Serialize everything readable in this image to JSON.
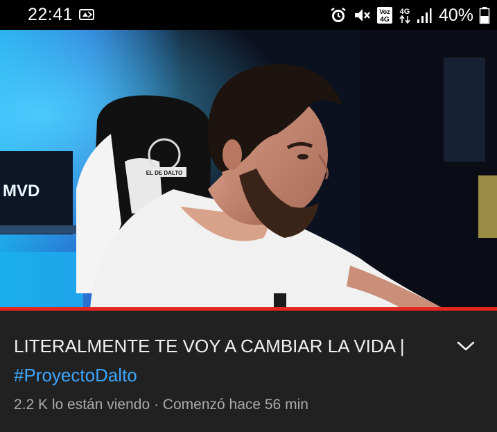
{
  "status_bar": {
    "time": "22:41",
    "battery_percent": "40%",
    "network_label": "4G",
    "volte_label_top": "Voz",
    "volte_label_bottom": "4G",
    "icons": [
      "alarm-icon",
      "mute-icon",
      "volte-icon",
      "network-4g-icon",
      "signal-icon",
      "battery-icon",
      "cast-notification-icon"
    ]
  },
  "video": {
    "watermark_chair": "EL DE DALTO",
    "monitor_brand": "MVD",
    "progress": 1.0,
    "progress_color": "#e52620"
  },
  "info": {
    "title_text": "LITERALMENTE TE VOY A CAMBIAR LA VIDA",
    "title_separator": "|",
    "hashtag": "#ProyectoDalto",
    "meta": "2.2 K lo están viendo · Comenzó hace 56 min",
    "expand_icon": "chevron-down-icon",
    "hashtag_color": "#3ea6ff"
  }
}
